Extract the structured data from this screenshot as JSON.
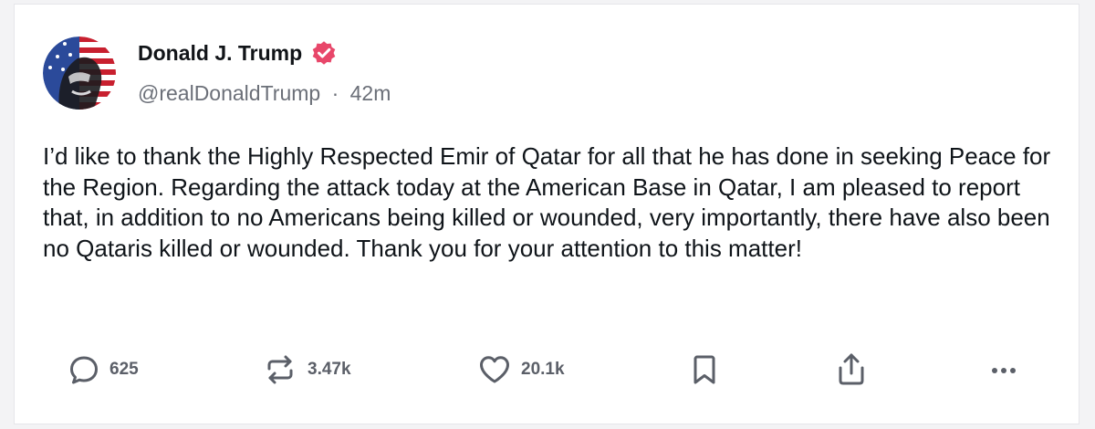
{
  "post": {
    "author_name": "Donald J. Trump",
    "handle": "@realDonaldTrump",
    "separator": "·",
    "time_ago": "42m",
    "text": "I’d like to thank the Highly Respected Emir of Qatar for all that he has done in seeking Peace for the Region. Regarding the attack today at the American Base in Qatar, I am pleased to report that, in addition to no Americans being killed or wounded, very importantly, there have also been no Qataris killed or wounded. Thank you for your attention to this matter!"
  },
  "badge": {
    "icon": "verified-badge-icon",
    "color": "#e8476a"
  },
  "actions": {
    "reply": {
      "icon": "reply-icon",
      "count": "625"
    },
    "repost": {
      "icon": "repost-icon",
      "count": "3.47k"
    },
    "like": {
      "icon": "heart-icon",
      "count": "20.1k"
    },
    "bookmark": {
      "icon": "bookmark-icon"
    },
    "share": {
      "icon": "share-icon"
    },
    "more": {
      "icon": "more-icon"
    }
  },
  "colors": {
    "text": "#0f1419",
    "muted": "#6b6f78",
    "icon": "#5b5f68"
  }
}
